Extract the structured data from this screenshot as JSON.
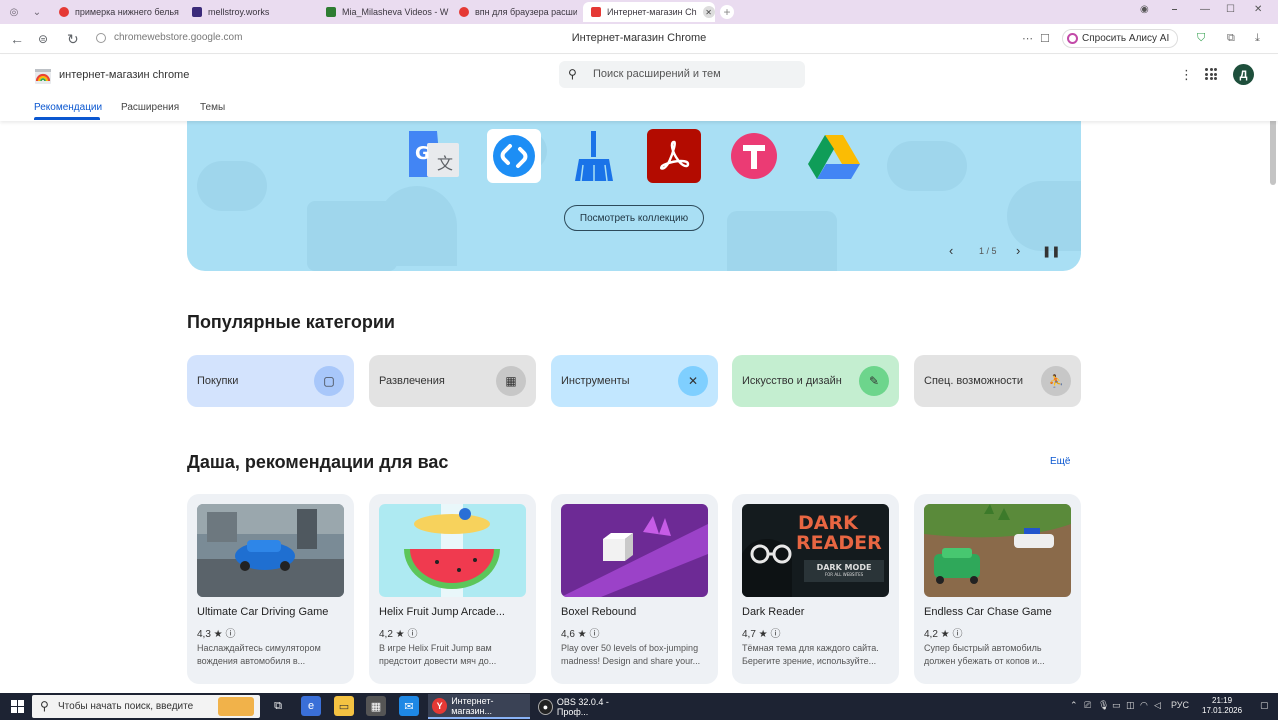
{
  "browser": {
    "tabs": [
      {
        "title": "примерка нижнего белья",
        "color": "#e53935"
      },
      {
        "title": "mellstroy.works",
        "color": "#3b2b7a"
      },
      {
        "title": "Mia_Milasheva Videos - W",
        "color": "#2e7d32"
      },
      {
        "title": "впн для браузера расши",
        "color": "#e53935"
      },
      {
        "title": "Интернет-магазин Ch",
        "color": "#e53935"
      }
    ],
    "url": "chromewebstore.google.com",
    "page_title": "Интернет-магазин Chrome",
    "alice_label": "Спросить Алису AI"
  },
  "store": {
    "name": "интернет-магазин chrome",
    "search_placeholder": "Поиск расширений и тем",
    "avatar_letter": "Д",
    "nav_tabs": [
      "Рекомендации",
      "Расширения",
      "Темы"
    ]
  },
  "hero": {
    "button_label": "Посмотреть коллекцию",
    "page_counter": "1 / 5",
    "apps": [
      "google-translate-icon",
      "shazam-icon",
      "cleaner-broom-icon",
      "adobe-acrobat-icon",
      "t-app-icon",
      "google-drive-icon"
    ]
  },
  "categories": {
    "title": "Популярные категории",
    "items": [
      {
        "label": "Покупки",
        "bg": "#d3e3fd",
        "icon_bg": "#a8c7fa",
        "icon": "🛍"
      },
      {
        "label": "Развлечения",
        "bg": "#e3e3e3",
        "icon_bg": "#c7c7c7",
        "icon": "▦"
      },
      {
        "label": "Инструменты",
        "bg": "#c2e7ff",
        "icon_bg": "#7fcfff",
        "icon": "✕"
      },
      {
        "label": "Искусство и дизайн",
        "bg": "#c4eed0",
        "icon_bg": "#6dd58c",
        "icon": "✎"
      },
      {
        "label": "Спец. возможности",
        "bg": "#e3e3e3",
        "icon_bg": "#c7c7c7",
        "icon": "♿"
      }
    ]
  },
  "recommendations": {
    "title": "Даша, рекомендации для вас",
    "more_label": "Ещё",
    "items": [
      {
        "name": "Ultimate Car Driving Game",
        "rating": "4,3 ★",
        "desc": "Наслаждайтесь симулятором вождения автомобиля в..."
      },
      {
        "name": "Helix Fruit Jump Arcade...",
        "rating": "4,2 ★",
        "desc": "В игре Helix Fruit Jump вам предстоит довести мяч до..."
      },
      {
        "name": "Boxel Rebound",
        "rating": "4,6 ★",
        "desc": "Play over 50 levels of box-jumping madness! Design and share your..."
      },
      {
        "name": "Dark Reader",
        "rating": "4,7 ★",
        "desc": "Тёмная тема для каждого сайта. Берегите зрение, используйте..."
      },
      {
        "name": "Endless Car Chase Game",
        "rating": "4,2 ★",
        "desc": "Супер быстрый автомобиль должен убежать от копов и..."
      }
    ],
    "dark_reader_thumb": {
      "line1": "DARK",
      "line2": "READER",
      "line3": "DARK MODE",
      "line4": "FOR ALL WEBSITES"
    }
  },
  "taskbar": {
    "search_placeholder": "Чтобы начать поиск, введите",
    "windows": [
      "Интернет-магазин...",
      "OBS 32.0.4 - Проф..."
    ],
    "language": "РУС",
    "time": "21:19",
    "date": "17.01.2026"
  }
}
